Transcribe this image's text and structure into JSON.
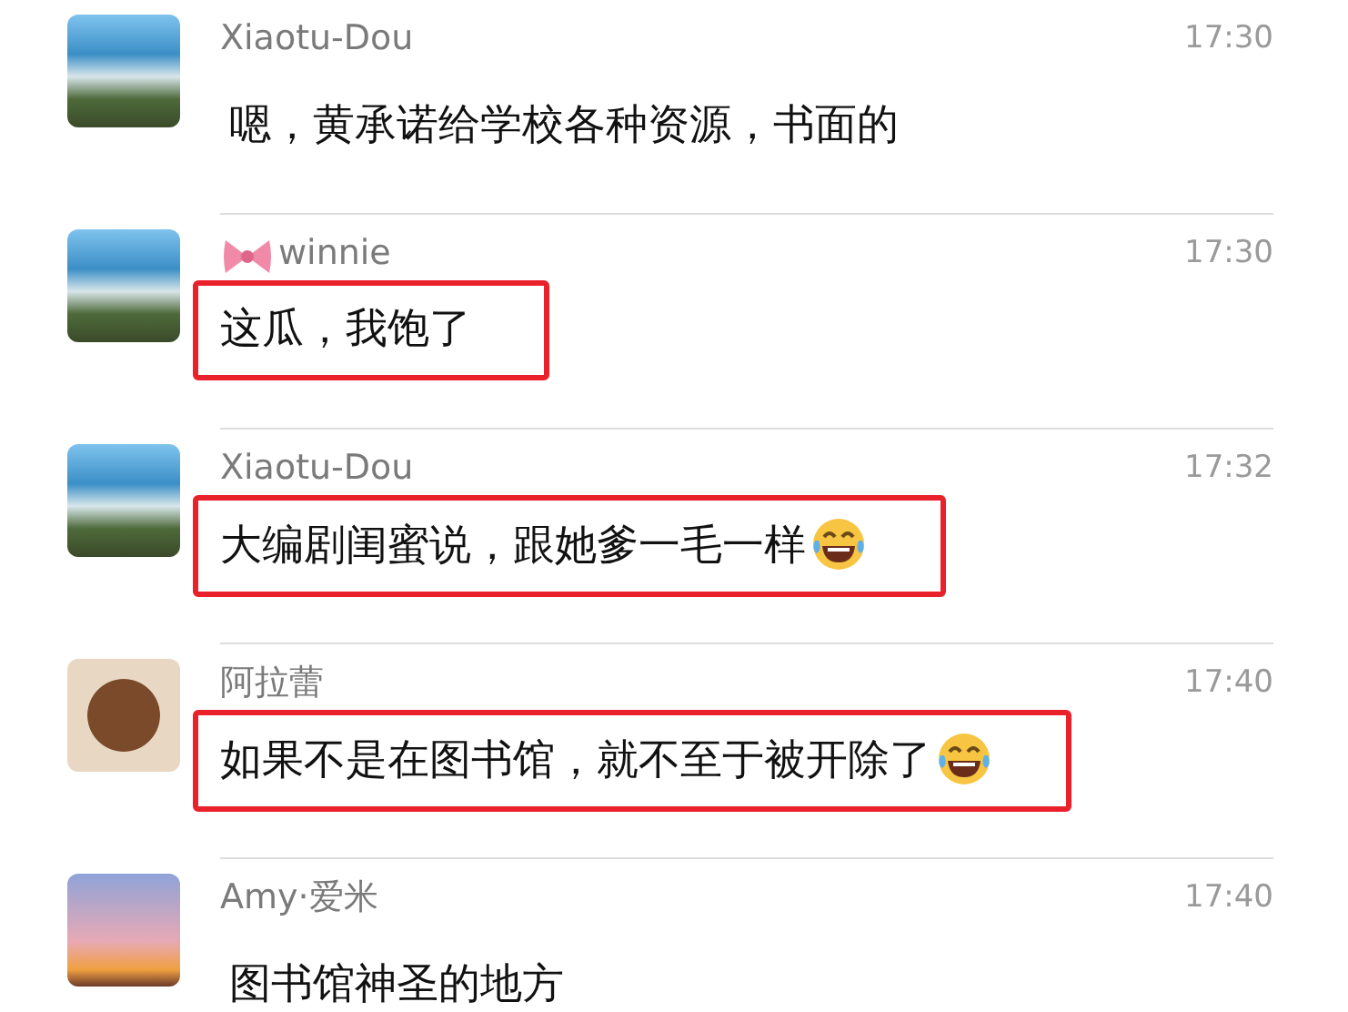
{
  "messages": [
    {
      "sender": "Xiaotu-Dou",
      "avatar": {
        "kind": "seascape"
      },
      "bow_icon": false,
      "time": "17:30",
      "text": "嗯，黄承诺给学校各种资源，书面的",
      "highlighted": false,
      "laugh_emoji": false
    },
    {
      "sender": "winnie",
      "avatar": {
        "kind": "seascape"
      },
      "bow_icon": true,
      "time": "17:30",
      "text": "这瓜，我饱了",
      "highlighted": true,
      "laugh_emoji": false
    },
    {
      "sender": "Xiaotu-Dou",
      "avatar": {
        "kind": "seascape"
      },
      "bow_icon": false,
      "time": "17:32",
      "text": "大编剧闺蜜说，跟她爹一毛一样",
      "highlighted": true,
      "laugh_emoji": true
    },
    {
      "sender": "阿拉蕾",
      "avatar": {
        "kind": "toy"
      },
      "bow_icon": false,
      "time": "17:40",
      "text": "如果不是在图书馆，就不至于被开除了",
      "highlighted": true,
      "laugh_emoji": true
    },
    {
      "sender": "Amy·爱米",
      "avatar": {
        "kind": "sunset"
      },
      "bow_icon": false,
      "time": "17:40",
      "text": "图书馆神圣的地方",
      "highlighted": false,
      "laugh_emoji": false
    }
  ]
}
